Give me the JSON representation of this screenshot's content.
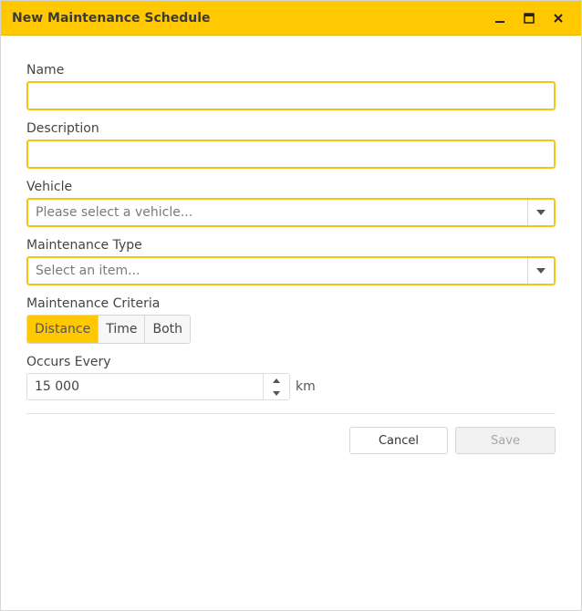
{
  "window": {
    "title": "New Maintenance Schedule",
    "controls": [
      {
        "icon": "minimize-icon"
      },
      {
        "icon": "maximize-icon"
      },
      {
        "icon": "close-icon"
      }
    ]
  },
  "form": {
    "name": {
      "label": "Name",
      "value": "",
      "placeholder": ""
    },
    "description": {
      "label": "Description",
      "value": "",
      "placeholder": ""
    },
    "vehicle": {
      "label": "Vehicle",
      "placeholder": "Please select a vehicle..."
    },
    "maintenance_type": {
      "label": "Maintenance Type",
      "placeholder": "Select an item..."
    },
    "criteria": {
      "label": "Maintenance Criteria",
      "options": [
        "Distance",
        "Time",
        "Both"
      ],
      "selected": "Distance"
    },
    "occurs_every": {
      "label": "Occurs Every",
      "value": "15 000",
      "unit": "km"
    }
  },
  "actions": {
    "cancel_label": "Cancel",
    "save_label": "Save"
  },
  "colors": {
    "accent": "#ffc800",
    "field_border": "#f2c513"
  }
}
